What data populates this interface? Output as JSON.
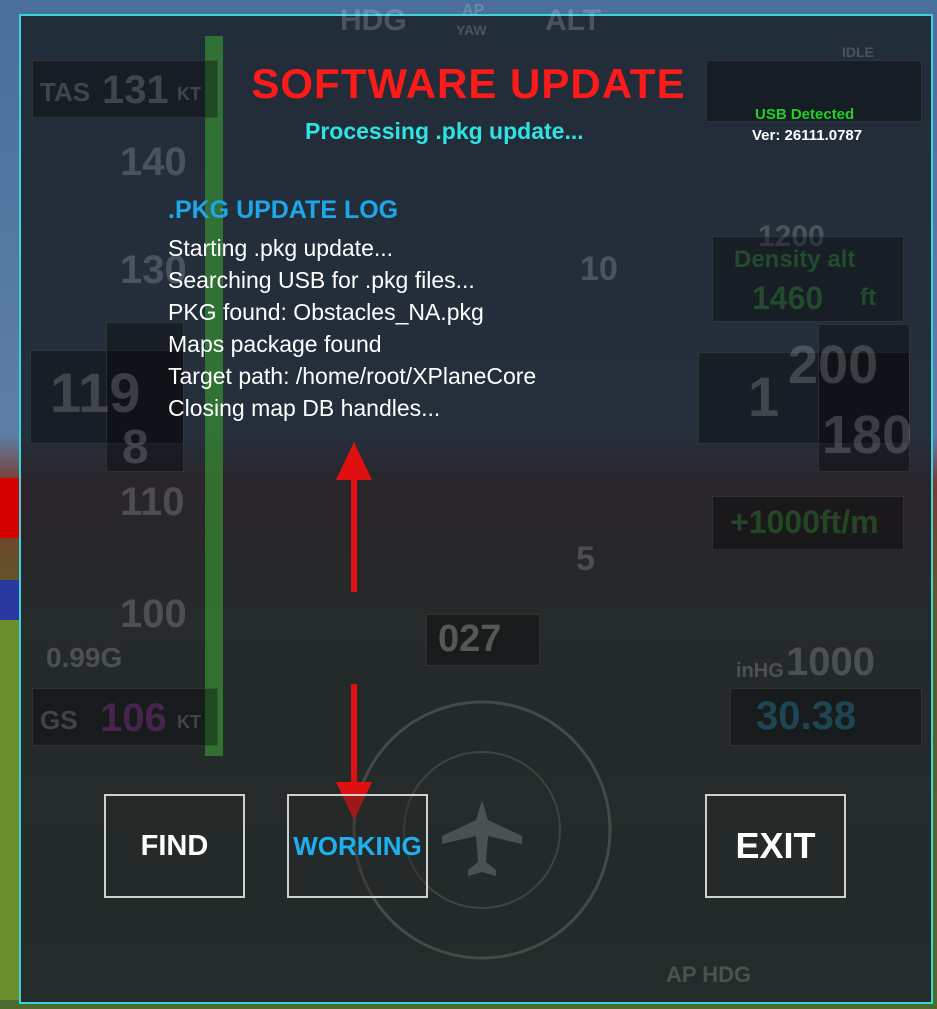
{
  "dialog": {
    "title": "SOFTWARE UPDATE",
    "subtitle": "Processing .pkg update...",
    "usb_status": "USB Detected",
    "version": "Ver: 26111.0787"
  },
  "log": {
    "heading": ".PKG UPDATE LOG",
    "lines": [
      "Starting .pkg update...",
      "Searching USB for .pkg files...",
      "PKG found: Obstacles_NA.pkg",
      "Maps package found",
      "Target path: /home/root/XPlaneCore",
      "Closing map DB handles..."
    ]
  },
  "buttons": {
    "find": "FIND",
    "working": "WORKING",
    "exit": "EXIT"
  },
  "background_instruments": {
    "hdg": "HDG",
    "ap": "AP",
    "yaw": "YAW",
    "alt": "ALT",
    "tas_label": "TAS",
    "tas_value": "131",
    "tas_unit": "KT",
    "gs_label": "GS",
    "gs_value": "106",
    "gs_unit": "KT",
    "g_load": "0.99G",
    "heading": "027",
    "density_alt_label": "Density alt",
    "density_alt_value": "1460",
    "density_alt_unit": "ft",
    "vs": "+1000ft/m",
    "baro_label": "inHG",
    "baro": "30.38",
    "ap_hdg": "AP HDG",
    "idle": "IDLE",
    "speed_ticks": [
      "140",
      "130",
      "110",
      "100"
    ],
    "speed_box_top": "119",
    "speed_box_bottom": "8",
    "alt_box_left": "1",
    "alt_box_top": "200",
    "alt_box_bottom": "180",
    "pitch_labels": [
      "10",
      "5"
    ],
    "alt_tape_ticks": [
      "1200",
      "1000"
    ]
  },
  "colors": {
    "title": "#ff1a1a",
    "subtitle": "#2ee3e3",
    "usb": "#21d021",
    "log_heading": "#1ea6ea",
    "working": "#1eb0ee",
    "border": "#39d4e0",
    "arrow": "#e01010"
  }
}
